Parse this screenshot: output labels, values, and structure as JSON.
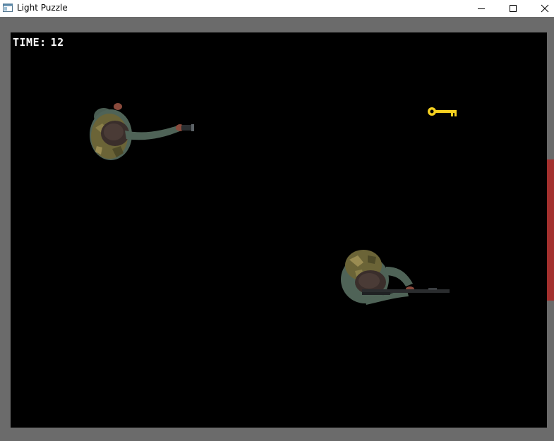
{
  "window": {
    "title": "Light Puzzle",
    "icon": "app-window-icon",
    "controls": {
      "minimize": "minimize-icon",
      "maximize": "maximize-icon",
      "close": "close-icon"
    }
  },
  "hud": {
    "time_label": "TIME:",
    "time_value": "12"
  },
  "colors": {
    "frame": "#6b6b6b",
    "playfield": "#000000",
    "side_bar": "#a3302e",
    "key": "#f5d020",
    "hud_text": "#ffffff"
  },
  "sprites": {
    "player": "soldier-with-flashlight",
    "enemy": "soldier-with-rifle",
    "pickup": "golden-key"
  }
}
